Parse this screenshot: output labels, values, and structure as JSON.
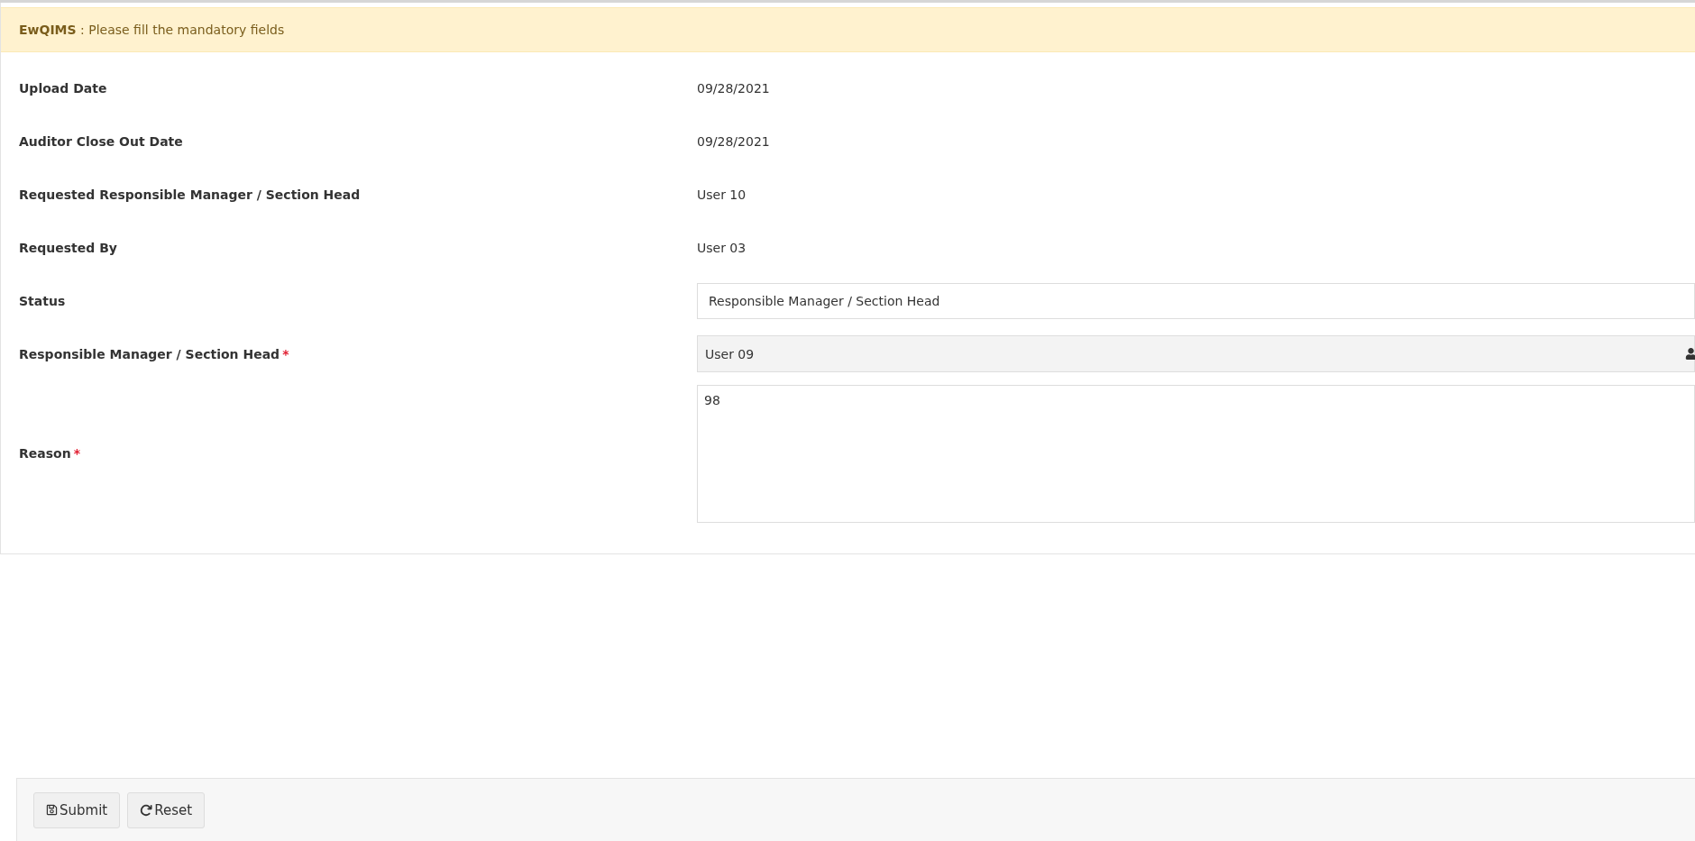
{
  "alert": {
    "message": "**EwQIMS** : Please fill the mandatory fields"
  },
  "fields": [
    {
      "label": "Upload Date",
      "kind": "text",
      "value": "09/28/2021"
    },
    {
      "label": "Auditor Close Out Date",
      "kind": "text",
      "value": "09/28/2021"
    },
    {
      "label": "Requested Responsible Manager / Section Head",
      "kind": "text",
      "value": "User 10"
    },
    {
      "label": "Requested By",
      "kind": "text",
      "value": "User 03"
    },
    {
      "label": "Status",
      "kind": "input",
      "value": "Responsible Manager / Section Head"
    },
    {
      "label": "Responsible Manager / Section Head",
      "required_mark": "*",
      "kind": "lookup",
      "value": "User 09"
    },
    {
      "label": "Reason",
      "required_mark": "*",
      "kind": "textarea",
      "value": "98"
    }
  ],
  "buttons": [
    {
      "kind": "save",
      "label": "Submit"
    },
    {
      "kind": "reset",
      "label": "Reset"
    }
  ]
}
